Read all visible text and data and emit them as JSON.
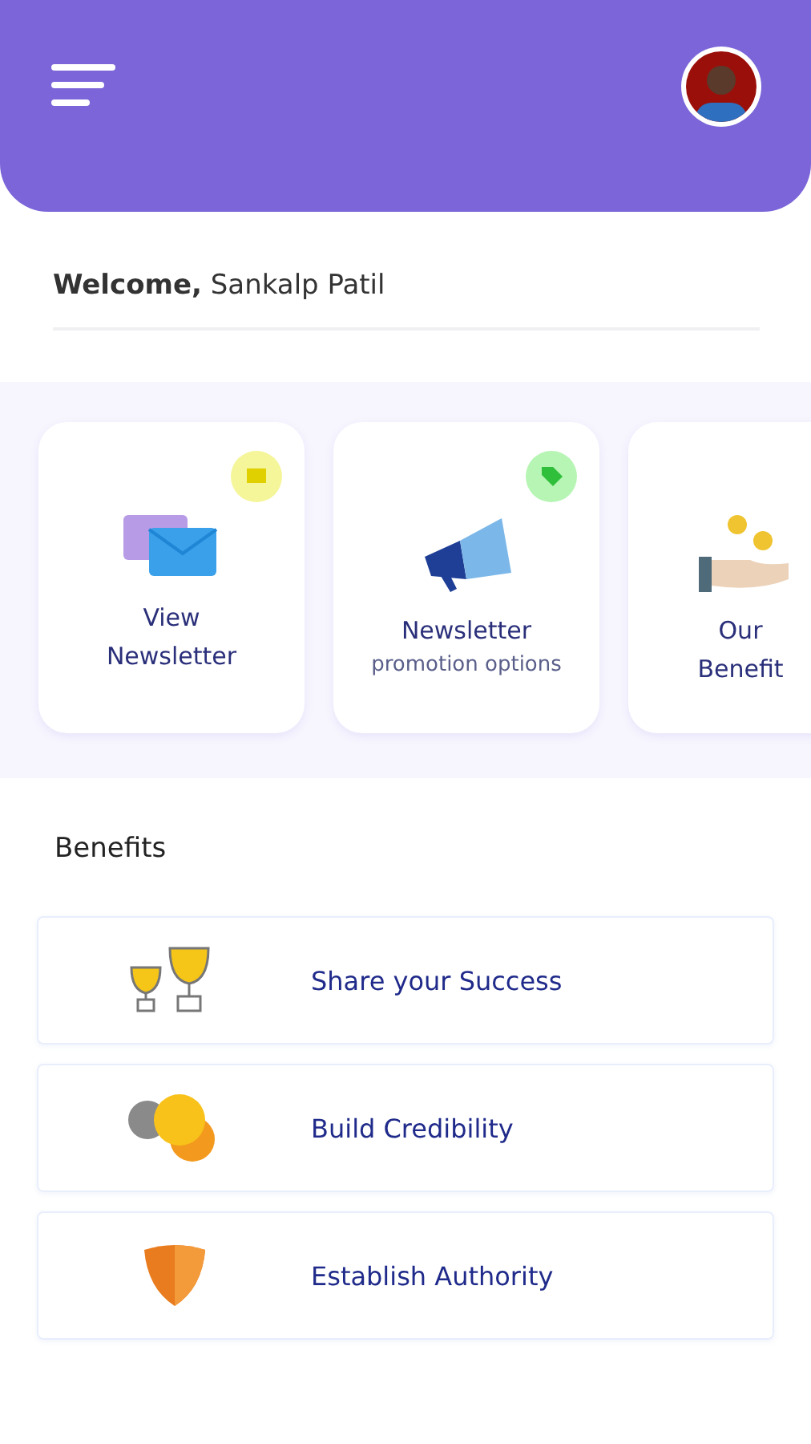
{
  "welcome": "**Welcome,** Sankalp Patil",
  "cards": [
    {
      "title": "View",
      "title_2": "Newsletter",
      "color": "#f5f59a"
    },
    {
      "title": "Newsletter",
      "subtitle": "promotion options",
      "color": "#b6f5b4"
    },
    {
      "title": "Our",
      "title_2": "Benefit"
    }
  ],
  "benefits_heading": "Benefits",
  "benefits": [
    {
      "label": "Share your Success"
    },
    {
      "label": "Build Credibility"
    },
    {
      "label": "Establish Authority"
    }
  ]
}
